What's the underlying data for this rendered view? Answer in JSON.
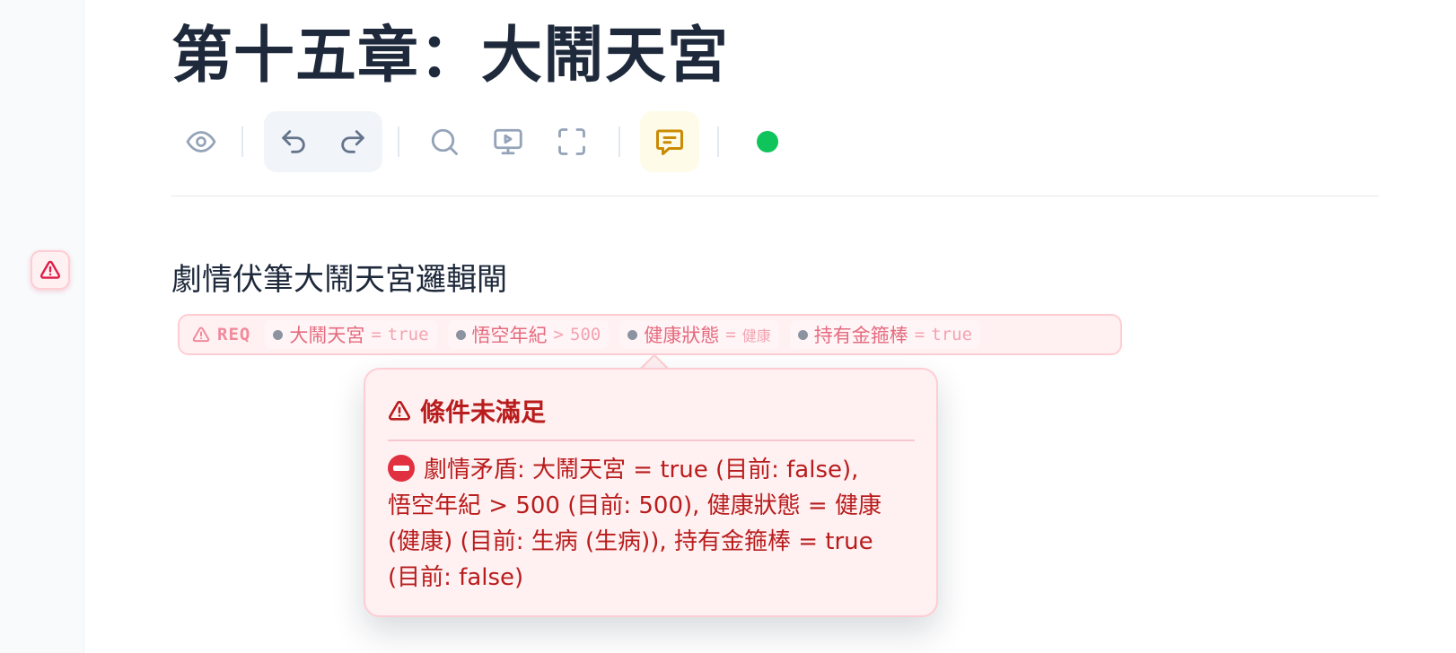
{
  "document": {
    "chapter_title": "第十五章：大鬧天宮",
    "paragraph": "劇情伏筆大鬧天宮邏輯閘"
  },
  "toolbar": {
    "items": [
      {
        "name": "preview",
        "icon": "eye-icon"
      },
      {
        "name": "undo",
        "icon": "undo-icon"
      },
      {
        "name": "redo",
        "icon": "redo-icon"
      },
      {
        "name": "search",
        "icon": "search-icon"
      },
      {
        "name": "presentation",
        "icon": "monitor-play-icon"
      },
      {
        "name": "fullscreen",
        "icon": "fullscreen-icon"
      },
      {
        "name": "comment",
        "icon": "comment-icon"
      }
    ],
    "status_color": "#10c45c"
  },
  "gate": {
    "label": "REQ",
    "conditions": [
      {
        "key": "大鬧天宮",
        "op": "=",
        "value": "true"
      },
      {
        "key": "悟空年紀",
        "op": ">",
        "value": "500"
      },
      {
        "key": "健康狀態",
        "op": "=",
        "value": "健康"
      },
      {
        "key": "持有金箍棒",
        "op": "=",
        "value": "true"
      }
    ]
  },
  "popover": {
    "title": "條件未滿足",
    "lines": [
      "劇情矛盾: 大鬧天宮 = true (目前: false),",
      "悟空年紀 > 500 (目前: 500), 健康狀態 = 健康",
      "(健康) (目前: 生病 (生病)), 持有金箍棒 = true",
      "(目前: false)"
    ]
  },
  "colors": {
    "error": "#b91c1c",
    "error_bg": "#fff1f2",
    "error_border": "#fecdd3",
    "title": "#1e293b"
  }
}
